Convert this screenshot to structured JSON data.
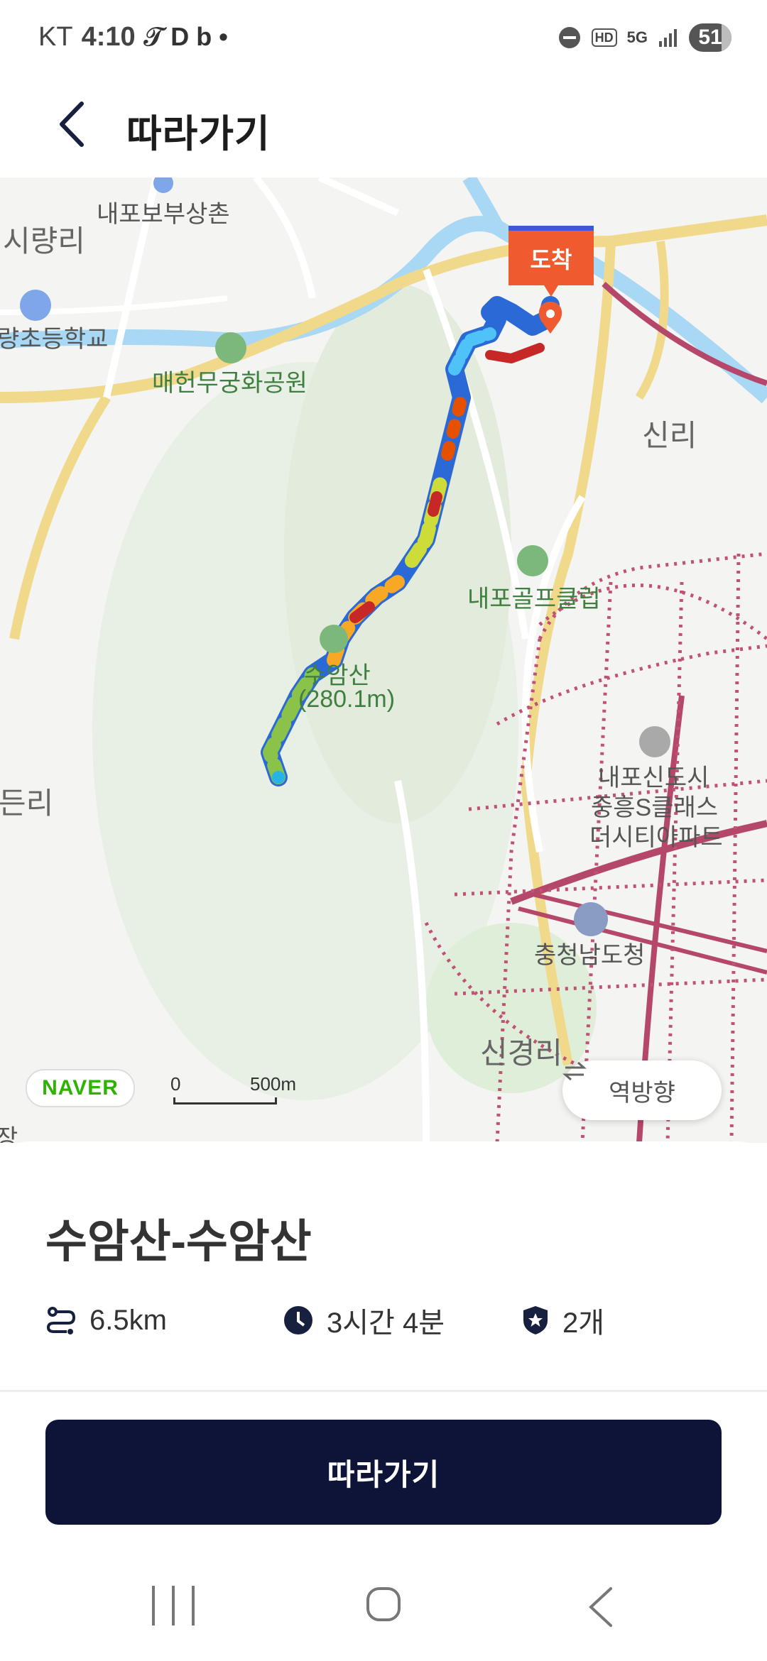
{
  "status_bar": {
    "carrier": "KT",
    "time": "4:10",
    "notification_symbols": "𝒯 D b •",
    "hd_badge": "HD",
    "network": "5G",
    "battery": "51"
  },
  "app_bar": {
    "title": "따라가기",
    "back_icon": "chevron-left-icon"
  },
  "map": {
    "labels": {
      "naepo_bosangchon": "내포보부상촌",
      "siryang_ri": "시량리",
      "elementary_school": "량초등학교",
      "maehun_park": "매헌무궁화공원",
      "sin_ri": "신리",
      "golf_club": "내포골프클럽",
      "suam_mountain": "수암산",
      "suam_elevation": "(280.1m)",
      "apartment_1": "내포신도시",
      "apartment_2": "중흥S클래스",
      "apartment_3": "더시티아파트",
      "provincial_office": "충청남도청",
      "singyeong_ri": "신경리",
      "left_ri": "든리",
      "left_bottom": "장"
    },
    "arrival_flag": "도착",
    "naver_logo": "NAVER",
    "scale_start": "0",
    "scale_end": "500m",
    "reverse_button": "역방향",
    "colors": {
      "route_start": "#27b3e6",
      "road_yellow": "#f5dc8f",
      "river": "#a9d8f5",
      "rail": "#b5476a",
      "arrival": "#ef5a2e"
    }
  },
  "route": {
    "title": "수암산-수암산",
    "distance": "6.5km",
    "duration": "3시간 4분",
    "badge_count": "2개",
    "icons": {
      "distance": "route-icon",
      "duration": "clock-icon",
      "badge": "shield-star-icon"
    }
  },
  "cta": {
    "follow_label": "따라가기"
  },
  "nav_bar": {
    "recent": "recent-apps-icon",
    "home": "home-icon",
    "back": "back-icon"
  }
}
